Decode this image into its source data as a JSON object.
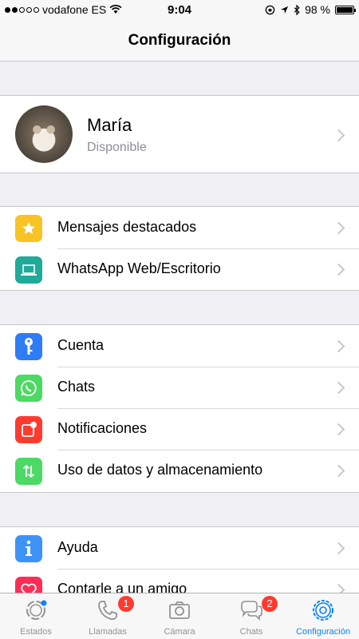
{
  "status_bar": {
    "carrier": "vodafone ES",
    "time": "9:04",
    "battery": "98 %",
    "battery_level": 0.98
  },
  "nav": {
    "title": "Configuración"
  },
  "profile": {
    "name": "María",
    "status": "Disponible"
  },
  "groups": [
    [
      {
        "label": "Mensajes destacados",
        "icon": "star-icon",
        "color": "#f7c325"
      },
      {
        "label": "WhatsApp Web/Escritorio",
        "icon": "laptop-icon",
        "color": "#1faa9a"
      }
    ],
    [
      {
        "label": "Cuenta",
        "icon": "key-icon",
        "color": "#2e7cf6"
      },
      {
        "label": "Chats",
        "icon": "whatsapp-icon",
        "color": "#4cd964"
      },
      {
        "label": "Notificaciones",
        "icon": "notification-icon",
        "color": "#ff3b30"
      },
      {
        "label": "Uso de datos y almacenamiento",
        "icon": "arrows-icon",
        "color": "#4cd964"
      }
    ],
    [
      {
        "label": "Ayuda",
        "icon": "info-icon",
        "color": "#3d93f5"
      },
      {
        "label": "Contarle a un amigo",
        "icon": "heart-icon",
        "color": "#ff2d55"
      }
    ]
  ],
  "tabs": [
    {
      "label": "Estados",
      "icon": "status-icon",
      "badge": ""
    },
    {
      "label": "Llamadas",
      "icon": "phone-icon",
      "badge": "1"
    },
    {
      "label": "Cámara",
      "icon": "camera-icon",
      "badge": ""
    },
    {
      "label": "Chats",
      "icon": "chat-bubbles-icon",
      "badge": "2"
    },
    {
      "label": "Configuración",
      "icon": "gear-icon",
      "badge": "",
      "active": true
    }
  ]
}
